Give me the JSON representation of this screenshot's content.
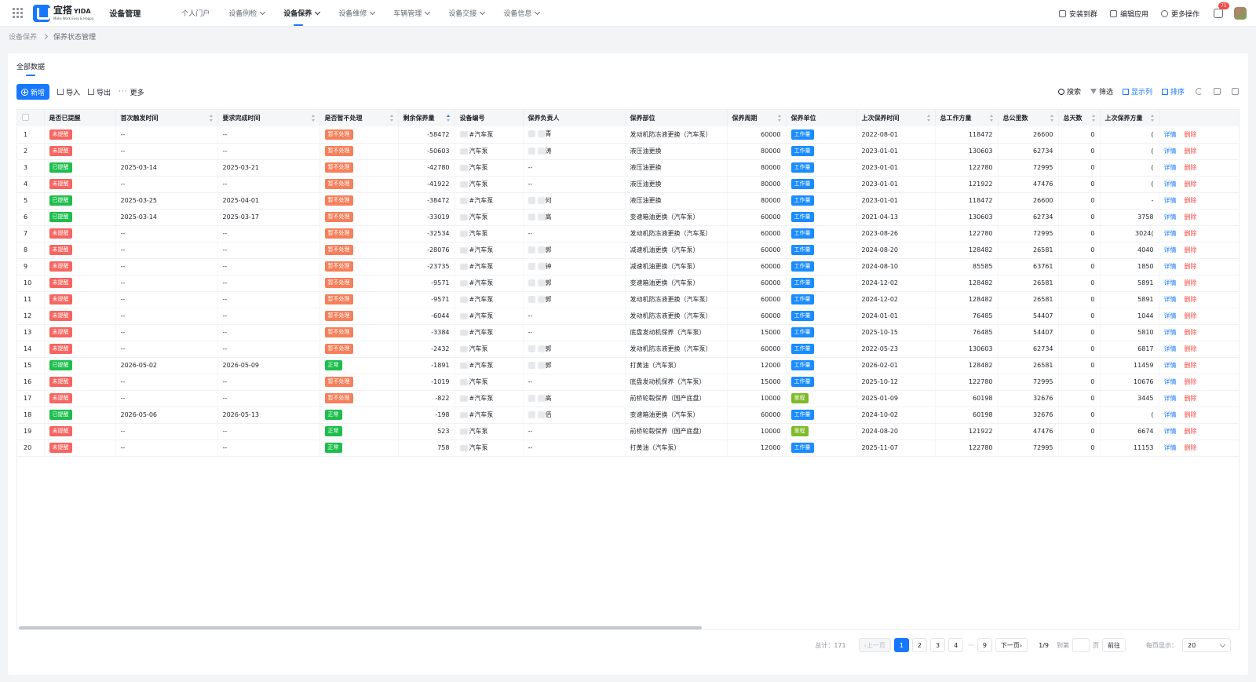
{
  "app": {
    "logo_text": "宜搭",
    "logo_brand": "YIDA",
    "logo_slogan": "Make Work Easy & Happy",
    "title": "设备管理"
  },
  "nav": [
    {
      "label": "个人门户",
      "dropdown": false,
      "active": false
    },
    {
      "label": "设备例检",
      "dropdown": true,
      "active": false
    },
    {
      "label": "设备保养",
      "dropdown": true,
      "active": true
    },
    {
      "label": "设备维修",
      "dropdown": true,
      "active": false
    },
    {
      "label": "车辆管理",
      "dropdown": true,
      "active": false
    },
    {
      "label": "设备交接",
      "dropdown": true,
      "active": false
    },
    {
      "label": "设备信息",
      "dropdown": true,
      "active": false
    }
  ],
  "top_actions": {
    "install": "安装到群",
    "edit": "编辑应用",
    "more": "更多操作",
    "notification_count": "71"
  },
  "breadcrumb": {
    "root": "设备保养",
    "current": "保养状态管理"
  },
  "tabs": {
    "all": "全部数据"
  },
  "toolbar": {
    "new": "新增",
    "import": "导入",
    "export": "导出",
    "more": "更多",
    "search": "搜索",
    "filter": "筛选",
    "columns": "显示列",
    "sort": "排序"
  },
  "table": {
    "headers": {
      "reminded": "是否已提醒",
      "first_trigger": "首次触发时间",
      "required_done": "要求完成时间",
      "suspend": "是否暂不处理",
      "remaining": "剩余保养量",
      "device_no": "设备编号",
      "owner": "保养负责人",
      "part": "保养部位",
      "cycle": "保养周期",
      "unit": "保养单位",
      "last_time": "上次保养时间",
      "total_work": "总工作方量",
      "total_km": "总公里数",
      "total_days": "总天数",
      "last_work": "上次保养方量"
    },
    "ops": {
      "detail": "详情",
      "delete": "删除"
    },
    "rows": [
      {
        "idx": "1",
        "reminded": "未提醒",
        "rc": "red",
        "first": "--",
        "req": "--",
        "suspend": "暂不处理",
        "sc": "orange",
        "remain": "-58472",
        "device": "#汽车泵",
        "owner": "青",
        "part": "发动机防冻液更换（汽车泵）",
        "cycle": "60000",
        "unit": "工作量",
        "uc": "blue",
        "last": "2022-08-01",
        "work": "118472",
        "km": "26600",
        "days": "0",
        "lastwork": "("
      },
      {
        "idx": "2",
        "reminded": "未提醒",
        "rc": "red",
        "first": "--",
        "req": "--",
        "suspend": "暂不处理",
        "sc": "orange",
        "remain": "-50603",
        "device": "汽车泵",
        "owner": "涛",
        "part": "液压油更换",
        "cycle": "80000",
        "unit": "工作量",
        "uc": "blue",
        "last": "2023-01-01",
        "work": "130603",
        "km": "62734",
        "days": "0",
        "lastwork": "("
      },
      {
        "idx": "3",
        "reminded": "已提醒",
        "rc": "green",
        "first": "2025-03-14",
        "req": "2025-03-21",
        "suspend": "暂不处理",
        "sc": "orange",
        "remain": "-42780",
        "device": "汽车泵",
        "owner": "--",
        "part": "液压油更换",
        "cycle": "80000",
        "unit": "工作量",
        "uc": "blue",
        "last": "2023-01-01",
        "work": "122780",
        "km": "72995",
        "days": "0",
        "lastwork": "("
      },
      {
        "idx": "4",
        "reminded": "未提醒",
        "rc": "red",
        "first": "--",
        "req": "--",
        "suspend": "暂不处理",
        "sc": "orange",
        "remain": "-41922",
        "device": "汽车泵",
        "owner": "--",
        "part": "液压油更换",
        "cycle": "80000",
        "unit": "工作量",
        "uc": "blue",
        "last": "2023-01-01",
        "work": "121922",
        "km": "47476",
        "days": "0",
        "lastwork": "("
      },
      {
        "idx": "5",
        "reminded": "已提醒",
        "rc": "green",
        "first": "2025-03-25",
        "req": "2025-04-01",
        "suspend": "暂不处理",
        "sc": "orange",
        "remain": "-38472",
        "device": "#汽车泵",
        "owner": "何",
        "part": "液压油更换",
        "cycle": "80000",
        "unit": "工作量",
        "uc": "blue",
        "last": "2023-01-01",
        "work": "118472",
        "km": "26600",
        "days": "0",
        "lastwork": "-"
      },
      {
        "idx": "6",
        "reminded": "已提醒",
        "rc": "green",
        "first": "2025-03-14",
        "req": "2025-03-17",
        "suspend": "暂不处理",
        "sc": "orange",
        "remain": "-33019",
        "device": "汽车泵",
        "owner": "高",
        "part": "变速箱油更换（汽车泵）",
        "cycle": "60000",
        "unit": "工作量",
        "uc": "blue",
        "last": "2021-04-13",
        "work": "130603",
        "km": "62734",
        "days": "0",
        "lastwork": "3758"
      },
      {
        "idx": "7",
        "reminded": "未提醒",
        "rc": "red",
        "first": "--",
        "req": "--",
        "suspend": "暂不处理",
        "sc": "orange",
        "remain": "-32534",
        "device": "汽车泵",
        "owner": "--",
        "part": "发动机防冻液更换（汽车泵）",
        "cycle": "60000",
        "unit": "工作量",
        "uc": "blue",
        "last": "2023-08-26",
        "work": "122780",
        "km": "72995",
        "days": "0",
        "lastwork": "3024("
      },
      {
        "idx": "8",
        "reminded": "未提醒",
        "rc": "red",
        "first": "--",
        "req": "--",
        "suspend": "暂不处理",
        "sc": "orange",
        "remain": "-28076",
        "device": "#汽车泵",
        "owner": "郭",
        "part": "减速机油更换（汽车泵）",
        "cycle": "60000",
        "unit": "工作量",
        "uc": "blue",
        "last": "2024-08-20",
        "work": "128482",
        "km": "26581",
        "days": "0",
        "lastwork": "4040"
      },
      {
        "idx": "9",
        "reminded": "未提醒",
        "rc": "red",
        "first": "--",
        "req": "--",
        "suspend": "暂不处理",
        "sc": "orange",
        "remain": "-23735",
        "device": "#汽车泵",
        "owner": "钟",
        "part": "减速机油更换（汽车泵）",
        "cycle": "60000",
        "unit": "工作量",
        "uc": "blue",
        "last": "2024-08-10",
        "work": "85585",
        "km": "63761",
        "days": "0",
        "lastwork": "1850"
      },
      {
        "idx": "10",
        "reminded": "未提醒",
        "rc": "red",
        "first": "--",
        "req": "--",
        "suspend": "暂不处理",
        "sc": "orange",
        "remain": "-9571",
        "device": "#汽车泵",
        "owner": "郭",
        "part": "变速箱油更换（汽车泵）",
        "cycle": "60000",
        "unit": "工作量",
        "uc": "blue",
        "last": "2024-12-02",
        "work": "128482",
        "km": "26581",
        "days": "0",
        "lastwork": "5891"
      },
      {
        "idx": "11",
        "reminded": "未提醒",
        "rc": "red",
        "first": "--",
        "req": "--",
        "suspend": "暂不处理",
        "sc": "orange",
        "remain": "-9571",
        "device": "#汽车泵",
        "owner": "郭",
        "part": "发动机防冻液更换（汽车泵）",
        "cycle": "60000",
        "unit": "工作量",
        "uc": "blue",
        "last": "2024-12-02",
        "work": "128482",
        "km": "26581",
        "days": "0",
        "lastwork": "5891"
      },
      {
        "idx": "12",
        "reminded": "未提醒",
        "rc": "red",
        "first": "--",
        "req": "--",
        "suspend": "暂不处理",
        "sc": "orange",
        "remain": "-6044",
        "device": "#汽车泵",
        "owner": "--",
        "part": "发动机防冻液更换（汽车泵）",
        "cycle": "60000",
        "unit": "工作量",
        "uc": "blue",
        "last": "2024-01-01",
        "work": "76485",
        "km": "54407",
        "days": "0",
        "lastwork": "1044"
      },
      {
        "idx": "13",
        "reminded": "未提醒",
        "rc": "red",
        "first": "--",
        "req": "--",
        "suspend": "暂不处理",
        "sc": "orange",
        "remain": "-3384",
        "device": "#汽车泵",
        "owner": "--",
        "part": "底盘发动机保养（汽车泵）",
        "cycle": "15000",
        "unit": "工作量",
        "uc": "blue",
        "last": "2025-10-15",
        "work": "76485",
        "km": "54407",
        "days": "0",
        "lastwork": "5810"
      },
      {
        "idx": "14",
        "reminded": "未提醒",
        "rc": "red",
        "first": "--",
        "req": "--",
        "suspend": "暂不处理",
        "sc": "orange",
        "remain": "-2432",
        "device": "汽车泵",
        "owner": "郭",
        "part": "发动机防冻液更换（汽车泵）",
        "cycle": "60000",
        "unit": "工作量",
        "uc": "blue",
        "last": "2022-05-23",
        "work": "130603",
        "km": "62734",
        "days": "0",
        "lastwork": "6817"
      },
      {
        "idx": "15",
        "reminded": "已提醒",
        "rc": "green",
        "first": "2026-05-02",
        "req": "2026-05-09",
        "suspend": "正常",
        "sc": "green",
        "remain": "-1891",
        "device": "#汽车泵",
        "owner": "郭",
        "part": "打黄油（汽车泵）",
        "cycle": "12000",
        "unit": "工作量",
        "uc": "blue",
        "last": "2026-02-01",
        "work": "128482",
        "km": "26581",
        "days": "0",
        "lastwork": "11459"
      },
      {
        "idx": "16",
        "reminded": "未提醒",
        "rc": "red",
        "first": "--",
        "req": "--",
        "suspend": "暂不处理",
        "sc": "orange",
        "remain": "-1019",
        "device": "汽车泵",
        "owner": "--",
        "part": "底盘发动机保养（汽车泵）",
        "cycle": "15000",
        "unit": "工作量",
        "uc": "blue",
        "last": "2025-10-12",
        "work": "122780",
        "km": "72995",
        "days": "0",
        "lastwork": "10676"
      },
      {
        "idx": "17",
        "reminded": "未提醒",
        "rc": "red",
        "first": "--",
        "req": "--",
        "suspend": "暂不处理",
        "sc": "orange",
        "remain": "-822",
        "device": "#汽车泵",
        "owner": "高",
        "part": "前桥轮毂保养（国产底盘）",
        "cycle": "10000",
        "unit": "里程",
        "uc": "lime",
        "last": "2025-01-09",
        "work": "60198",
        "km": "32676",
        "days": "0",
        "lastwork": "3445"
      },
      {
        "idx": "18",
        "reminded": "已提醒",
        "rc": "green",
        "first": "2026-05-06",
        "req": "2026-05-13",
        "suspend": "正常",
        "sc": "green",
        "remain": "-198",
        "device": "#汽车泵",
        "owner": "佰",
        "part": "变速箱油更换（汽车泵）",
        "cycle": "60000",
        "unit": "工作量",
        "uc": "blue",
        "last": "2024-10-02",
        "work": "60198",
        "km": "32676",
        "days": "0",
        "lastwork": "("
      },
      {
        "idx": "19",
        "reminded": "未提醒",
        "rc": "red",
        "first": "--",
        "req": "--",
        "suspend": "正常",
        "sc": "green",
        "remain": "523",
        "device": "汽车泵",
        "owner": "--",
        "part": "前桥轮毂保养（国产底盘）",
        "cycle": "10000",
        "unit": "里程",
        "uc": "lime",
        "last": "2024-08-20",
        "work": "121922",
        "km": "47476",
        "days": "0",
        "lastwork": "6674"
      },
      {
        "idx": "20",
        "reminded": "未提醒",
        "rc": "red",
        "first": "--",
        "req": "--",
        "suspend": "正常",
        "sc": "green",
        "remain": "758",
        "device": "汽车泵",
        "owner": "--",
        "part": "打黄油（汽车泵）",
        "cycle": "12000",
        "unit": "工作量",
        "uc": "blue",
        "last": "2025-11-07",
        "work": "122780",
        "km": "72995",
        "days": "0",
        "lastwork": "11153"
      }
    ]
  },
  "pagination": {
    "total": "总计：171",
    "prev": "上一页",
    "next": "下一页",
    "pages": [
      "1",
      "2",
      "3",
      "4"
    ],
    "ellipsis": "···",
    "last_page": "9",
    "current": "1",
    "page_info": "1/9",
    "goto_label": "到第",
    "page_unit": "页",
    "goto_btn": "前往",
    "size_label": "每页显示：",
    "size_value": "20"
  },
  "colors": {
    "accent": "#1677ff",
    "red": "#f76560",
    "green": "#1dbe4c",
    "orange": "#f77f5b",
    "blue": "#1a8cff",
    "lime": "#7fbb28"
  }
}
